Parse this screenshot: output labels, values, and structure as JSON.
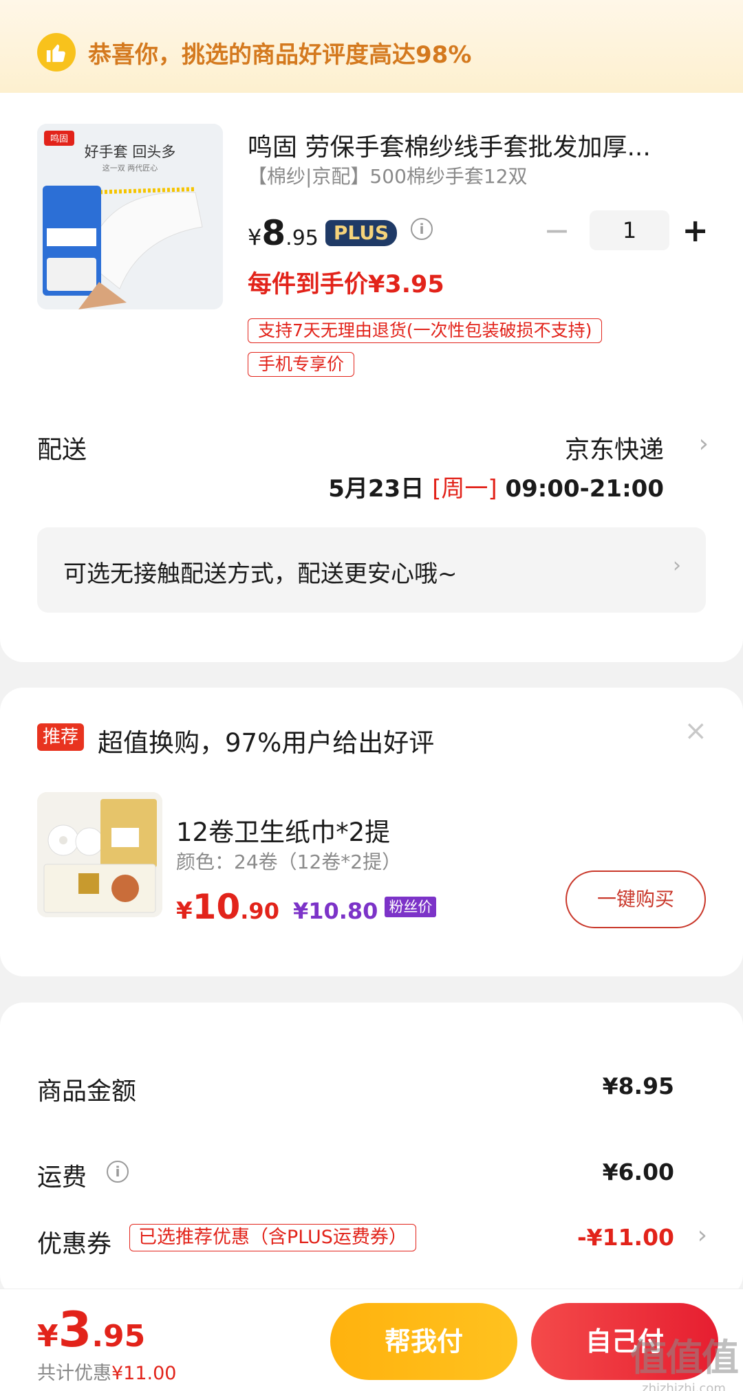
{
  "banner": {
    "text": "恭喜你，挑选的商品好评度高达98%"
  },
  "product": {
    "image_caption_brand": "鸣固",
    "image_caption_slogan": "好手套 回头多",
    "image_caption_sub": "这一双 两代匠心",
    "title": "鸣固 劳保手套棉纱线手套批发加厚...",
    "spec": "【棉纱|京配】500棉纱手套12双",
    "price_yen": "¥",
    "price_int": "8",
    "price_dec": ".95",
    "plus_badge": "PLUS",
    "quantity": "1",
    "minus_label": "−",
    "plus_label": "+",
    "unit_price": "每件到手价¥3.95",
    "tags": [
      "支持7天无理由退货(一次性包装破损不支持)",
      "手机专享价"
    ]
  },
  "delivery": {
    "label": "配送",
    "carrier": "京东快递",
    "date": "5月23日",
    "weekday": "[周一]",
    "time": "09:00-21:00",
    "contactless": "可选无接触配送方式，配送更安心哦~"
  },
  "recommend": {
    "badge": "推荐",
    "title": "超值换购，97%用户给出好评",
    "close": "×",
    "item_name": "12卷卫生纸巾*2提",
    "item_spec": "颜色：24卷（12卷*2提）",
    "price_yen": "¥",
    "price_int": "10",
    "price_dec": ".90",
    "fan_price": "¥10.80",
    "fan_tag": "粉丝价",
    "buy_button": "一键购买"
  },
  "summary": {
    "goods_label": "商品金额",
    "goods_value": "¥8.95",
    "shipping_label": "运费",
    "shipping_value": "¥6.00",
    "coupon_label": "优惠券",
    "coupon_tag": "已选推荐优惠（含PLUS运费券）",
    "coupon_value": "-¥11.00"
  },
  "bottom": {
    "total_yen": "¥",
    "total_int": "3",
    "total_dec": ".95",
    "discount_label": "共计优惠",
    "discount_value": "¥11.00",
    "help_pay": "帮我付",
    "self_pay": "自己付"
  },
  "watermark": {
    "big": "值值值",
    "small": "zhizhizhi.com"
  },
  "colors": {
    "accent_red": "#e2231a",
    "plus_navy": "#1f3a66",
    "fan_purple": "#7c33c8",
    "banner_orange": "#d4791e",
    "help_yellow": "#ffb20e"
  }
}
